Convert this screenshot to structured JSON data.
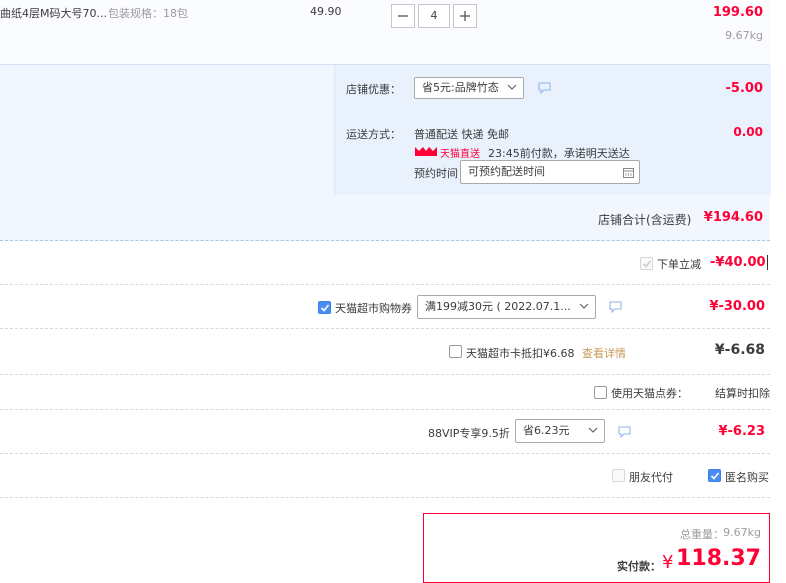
{
  "item": {
    "name": "曲纸4层M码大号70...",
    "spec": "包装规格：18包",
    "unit_price": "49.90",
    "quantity": "4",
    "subtotal": "199.60",
    "weight": "9.67kg"
  },
  "shop": {
    "discount_label": "店铺优惠：",
    "discount_value": "省5元:品牌竹态",
    "discount_amount": "-5.00",
    "shipping_label": "运送方式：",
    "shipping_method": "普通配送 快递 免邮",
    "shipping_amount": "0.00",
    "tmall_direct_badge": "天猫直送",
    "delivery_promise": "23:45前付款，承诺明天送达",
    "reserve_label": "预约时间",
    "reserve_placeholder": "可预约配送时间",
    "total_label": "店铺合计(含运费)",
    "total_amount": "¥194.60"
  },
  "instant_discount": {
    "label": "下单立减",
    "amount": "-¥40.00"
  },
  "coupon": {
    "label": "天猫超市购物券",
    "value": "满199减30元 ( 2022.07.1...",
    "amount": "¥-30.00"
  },
  "card": {
    "label": "天猫超市卡抵扣¥6.68",
    "link": "查看详情",
    "amount": "¥-6.68"
  },
  "points": {
    "label": "使用天猫点券：",
    "note": "结算时扣除"
  },
  "vip": {
    "label": "88VIP专享9.5折",
    "value": "省6.23元",
    "amount": "¥-6.23"
  },
  "options": {
    "friend_pay": "朋友代付",
    "anonymous": "匿名购买"
  },
  "summary": {
    "weight_label": "总重量：",
    "weight": "9.67kg",
    "pay_label": "实付款：",
    "currency": "¥",
    "amount": "118.37"
  },
  "colors": {
    "accent": "#ff0036",
    "panel": "#f2f7ff",
    "checkbox": "#4a8ef5"
  },
  "icons": [
    "minus-icon",
    "plus-icon",
    "chevron-down-icon",
    "message-icon",
    "calendar-icon",
    "check-icon",
    "tmall-icon"
  ]
}
